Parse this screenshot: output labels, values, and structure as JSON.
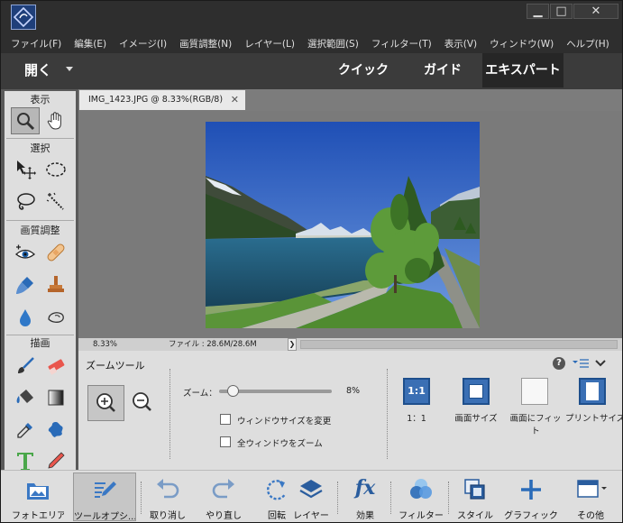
{
  "window": {
    "minimize": "▁",
    "maximize": "□",
    "close": "✕"
  },
  "menu": [
    "ファイル(F)",
    "編集(E)",
    "イメージ(I)",
    "画質調整(N)",
    "レイヤー(L)",
    "選択範囲(S)",
    "フィルター(T)",
    "表示(V)",
    "ウィンドウ(W)",
    "ヘルプ(H)"
  ],
  "modes": {
    "open": "開く",
    "quick": "クイック",
    "guided": "ガイド",
    "expert": "エキスパート"
  },
  "toolbox": {
    "view": "表示",
    "select": "選択",
    "enhance": "画質調整",
    "draw": "描画"
  },
  "document": {
    "tab_title": "IMG_1423.JPG @ 8.33%(RGB/8)",
    "close": "✕"
  },
  "status": {
    "zoom": "8.33%",
    "file": "ファイル : 28.6M/28.6M",
    "arrow": "❯"
  },
  "options": {
    "title": "ズームツール",
    "zoom_label": "ズーム：",
    "zoom_value": "8%",
    "zoom_level": 0.08,
    "resize_windows": "ウィンドウサイズを変更",
    "zoom_all_windows": "全ウィンドウをズーム",
    "help": "?",
    "btn_1to1_icon": "1:1",
    "btn_1to1": "1：1",
    "btn_fit_screen": "画面サイズ",
    "btn_fill_screen": "画面にフィット",
    "btn_print_size": "プリントサイズ"
  },
  "bottombar": {
    "photo_bin": "フォトエリア",
    "tool_options": "ツールオプシ...",
    "undo": "取り消し",
    "redo": "やり直し",
    "rotate": "回転",
    "layers": "レイヤー",
    "effects": "効果",
    "filters": "フィルター",
    "styles": "スタイル",
    "graphics": "グラフィック",
    "more": "その他"
  },
  "colors": {
    "accent": "#3a6fb4",
    "dark_bar": "#2e2e2e",
    "panel": "#dedede"
  }
}
